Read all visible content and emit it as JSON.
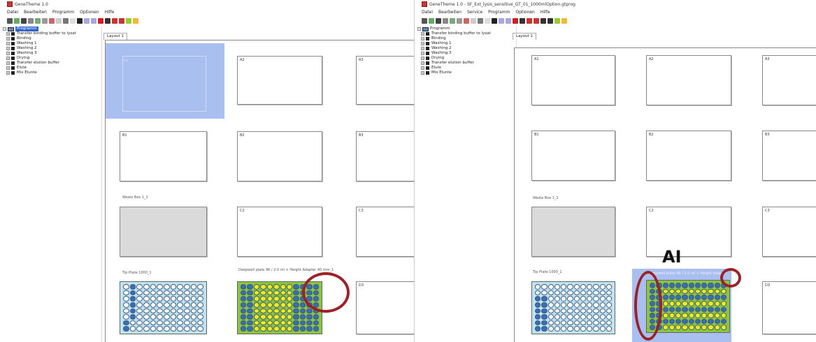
{
  "left": {
    "title": "GeneTheme 1.0",
    "menu": [
      "Datei",
      "Bearbeiten",
      "Programm",
      "Optionen",
      "Hilfe"
    ],
    "tree_root": "Programm",
    "tree_items": [
      "Transfer binding buffer to lysat",
      "Binding",
      "Washing 1",
      "Washing 2",
      "Washing 3",
      "Drying",
      "Transfer elution buffer",
      "Elute",
      "Mix Elunte"
    ],
    "tab": "Layout 1",
    "slots": {
      "a1": "A1",
      "a2": "A2",
      "a3": "A3",
      "b1": "B1",
      "b2": "B2",
      "b3": "B3",
      "c1": "Waste Box 1_1",
      "c2": "C2",
      "c3": "C3",
      "d1": "Tip Plate 1000_1",
      "d2": "Deepwell plate 96 / 2.0 ml + Height Adapter 40 mm_1",
      "d3": "D3"
    }
  },
  "right": {
    "title": "GeneTheme 1.0 - SF_Ext_lysis_sensitive_GT_01_1000mlOption.gtprog",
    "menu": [
      "Datei",
      "Bearbeiten",
      "Service",
      "Programm",
      "Optionen",
      "Hilfe"
    ],
    "tree_root": "Programm",
    "tree_items": [
      "Transfer binding buffer to lysat",
      "Binding",
      "Washing 1",
      "Washing 2",
      "Washing 3",
      "Drying",
      "Transfer elution buffer",
      "Elute",
      "Mix Elunte"
    ],
    "tab": "Layout 1",
    "slots": {
      "a1": "A1",
      "a2": "A2",
      "a3": "A3",
      "b1": "B1",
      "b2": "B2",
      "b3": "B3",
      "c1": "Waste Box 1_1",
      "c2": "C2",
      "c3": "C3",
      "d1": "Tip Plate 1000_1",
      "d2": "Deepwell plate 96 / 2.0 ml + Height Adapter",
      "d3": "D3"
    }
  },
  "annotation": "AI",
  "colors": {
    "accent": "#3264c8",
    "selection": "#a9bff0",
    "annotation_ring": "#9b2226",
    "plate_green": "#8bc53f",
    "well_yellow": "#f2ea1c",
    "well_blue": "#3b6db4",
    "tip_bg": "#bfe3f0"
  }
}
